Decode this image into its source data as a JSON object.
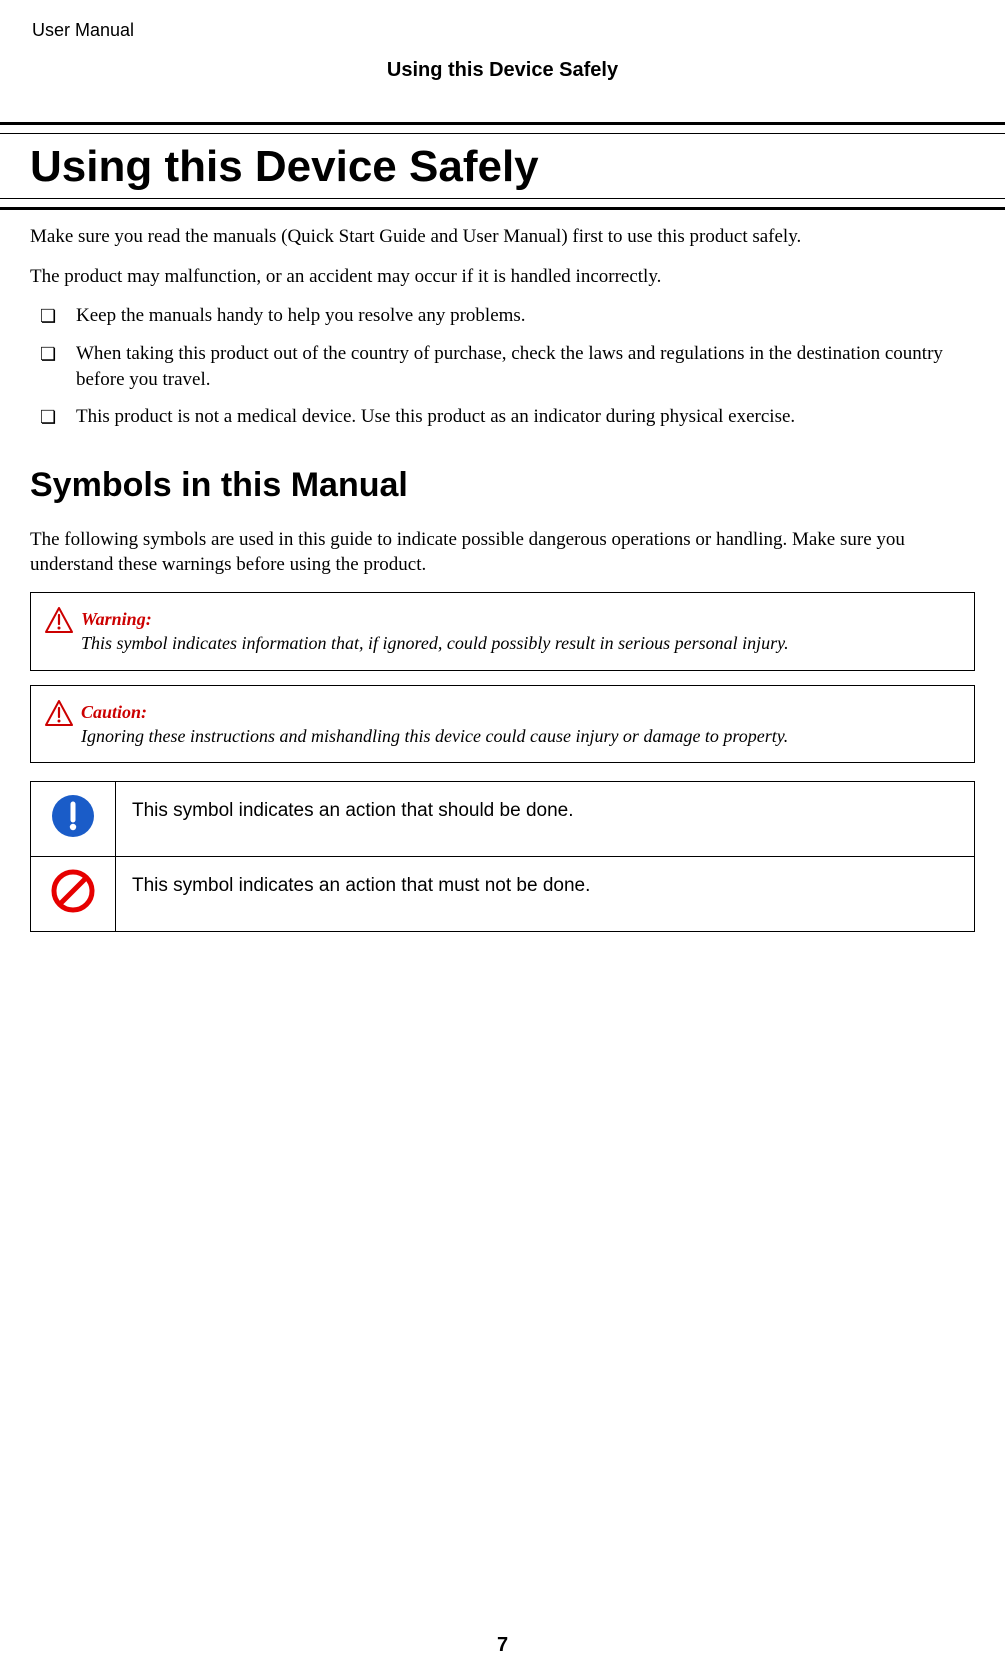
{
  "header": {
    "document_label": "User Manual",
    "running_head": "Using this Device Safely"
  },
  "title": "Using this Device Safely",
  "intro": {
    "p1": "Make sure you read the manuals (Quick Start Guide and User Manual) first to use this product safely.",
    "p2": "The product may malfunction, or an accident may occur if it is handled incorrectly."
  },
  "bullets": [
    "Keep the manuals handy to help you resolve any problems.",
    "When taking this product out of the country of purchase, check the laws and regulations in the destination country before you travel.",
    "This product is not a medical device. Use this product as an indicator during physical exercise."
  ],
  "section2": {
    "heading": "Symbols in this Manual",
    "intro": "The following symbols are used in this guide to indicate possible dangerous operations or handling. Make sure you understand these warnings before using the product."
  },
  "callouts": {
    "warning_label": "Warning:",
    "warning_text": "This symbol indicates information that, if ignored, could possibly result in serious personal injury.",
    "caution_label": "Caution:",
    "caution_text": "Ignoring these instructions and mishandling this device could cause injury or damage to property."
  },
  "symbol_table": {
    "row1": "This symbol indicates an action that should be done.",
    "row2": "This symbol indicates an action that must not be done."
  },
  "page_number": "7"
}
